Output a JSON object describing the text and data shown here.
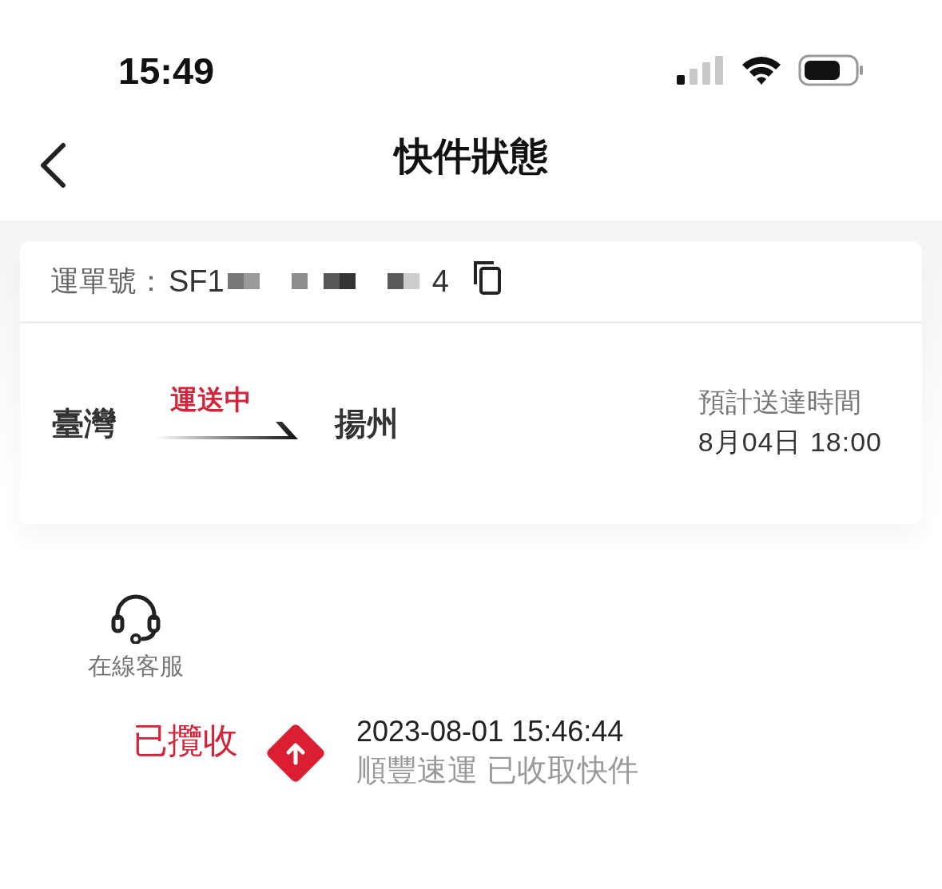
{
  "status_bar": {
    "time": "15:49"
  },
  "header": {
    "title": "快件狀態"
  },
  "waybill": {
    "label": "運單號：",
    "visible_start": "SF1",
    "visible_end": "4"
  },
  "route": {
    "origin": "臺灣",
    "status": "運送中",
    "destination": "揚州",
    "eta_label": "預計送達時間",
    "eta": "8月04日 18:00"
  },
  "service": {
    "label": "在線客服"
  },
  "timeline": [
    {
      "stage": "已攬收",
      "time": "2023-08-01 15:46:44",
      "description": "順豐速運 已收取快件"
    }
  ]
}
